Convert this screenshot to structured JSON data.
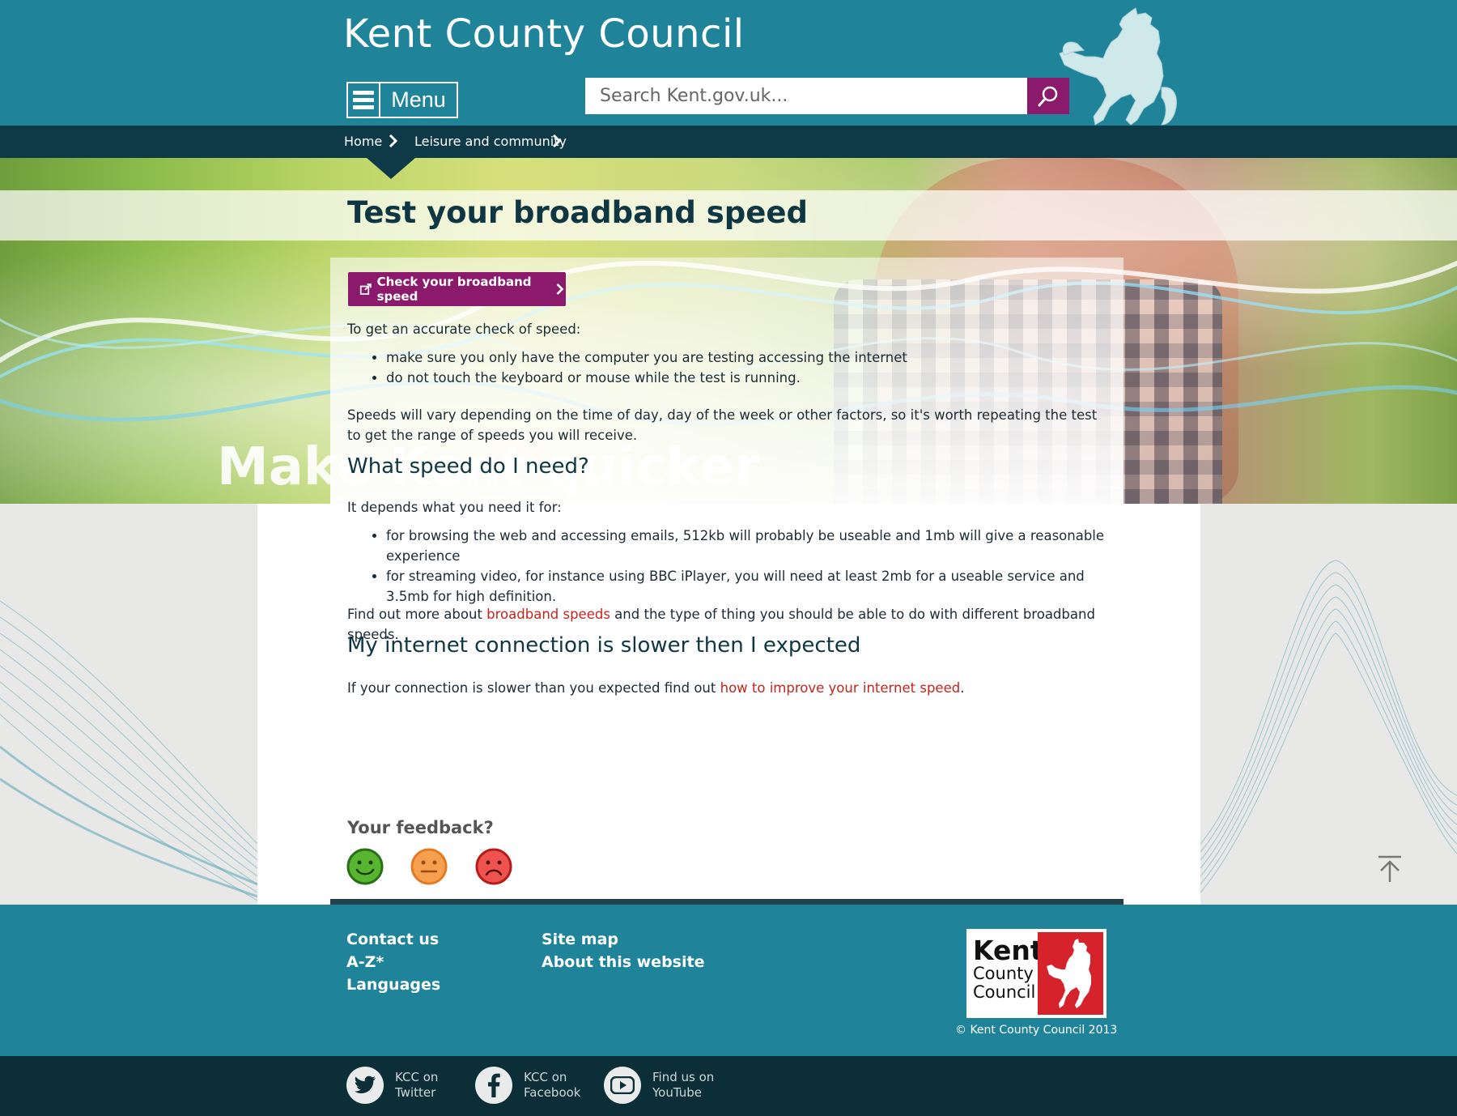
{
  "header": {
    "site_title": "Kent County Council",
    "menu_label": "Menu",
    "search_placeholder": "Search Kent.gov.uk..."
  },
  "breadcrumb": [
    "Home",
    "Leisure and community"
  ],
  "hero": {
    "tagline": "Make Kent quicker",
    "page_title": "Test your broadband speed"
  },
  "content": {
    "cta_label": "Check your broadband speed",
    "intro": "To get an accurate check of speed:",
    "tips": [
      "make sure you only have the computer you are testing accessing the internet",
      "do not touch the keyboard or mouse while the test is running."
    ],
    "vary": "Speeds will vary depending on the time of day, day of the week or other factors, so it's worth repeating the test to get the range of speeds you will receive.",
    "h_speed": "What speed do I need?",
    "depends": "It depends what you need it for:",
    "needs": [
      "for browsing the web and accessing emails, 512kb will probably be useable and 1mb will give a reasonable experience",
      "for streaming video, for instance using BBC iPlayer, you will need at least 2mb for a useable service and 3.5mb for high definition."
    ],
    "findout_pre": "Find out more about ",
    "findout_link": "broadband speeds",
    "findout_post": " and the type of thing you should be able to do with different broadband speeds.",
    "h_slow": "My internet connection is slower then I expected",
    "slow_pre": "If your connection is slower than you expected find out ",
    "slow_link": "how to improve your internet speed",
    "slow_post": "."
  },
  "feedback": {
    "title": "Your feedback?",
    "faces": [
      "happy-face",
      "neutral-face",
      "sad-face"
    ]
  },
  "footer": {
    "col1": [
      "Contact us",
      "A-Z*",
      "Languages"
    ],
    "col2": [
      "Site map",
      "About this website"
    ],
    "logo_line1": "Kent",
    "logo_line2": "County",
    "logo_line3": "Council",
    "copyright": "© Kent County Council 2013"
  },
  "social": [
    {
      "line1": "KCC on",
      "line2": "Twitter",
      "icon": "twitter-icon"
    },
    {
      "line1": "KCC on",
      "line2": "Facebook",
      "icon": "facebook-icon"
    },
    {
      "line1": "Find us on",
      "line2": "YouTube",
      "icon": "youtube-icon"
    }
  ],
  "colors": {
    "header": "#1f8399",
    "breadcrumb_bar": "#0e3a47",
    "accent_purple": "#8b1a6d",
    "link_red": "#c7241c",
    "footer_dark": "#0c2f37"
  }
}
